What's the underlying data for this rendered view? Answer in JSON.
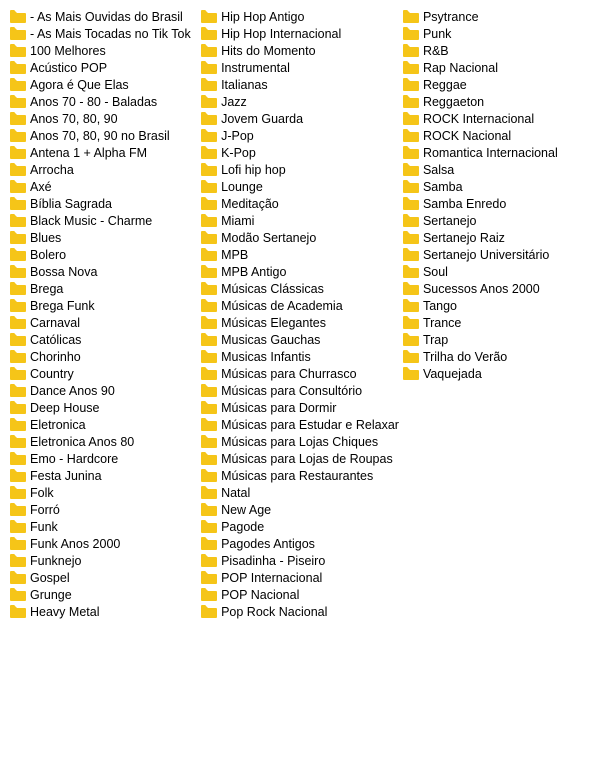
{
  "columns": [
    {
      "id": "col1",
      "items": [
        "- As Mais Ouvidas do Brasil",
        "- As Mais Tocadas no Tik Tok",
        "100 Melhores",
        "Acústico POP",
        "Agora é Que Elas",
        "Anos 70 - 80 - Baladas",
        "Anos 70, 80, 90",
        "Anos 70, 80, 90 no Brasil",
        "Antena 1 + Alpha FM",
        "Arrocha",
        "Axé",
        "Bíblia Sagrada",
        "Black Music - Charme",
        "Blues",
        "Bolero",
        "Bossa Nova",
        "Brega",
        "Brega Funk",
        "Carnaval",
        "Católicas",
        "Chorinho",
        "Country",
        "Dance Anos 90",
        "Deep House",
        "Eletronica",
        "Eletronica Anos 80",
        "Emo - Hardcore",
        "Festa Junina",
        "Folk",
        "Forró",
        "Funk",
        "Funk Anos 2000",
        "Funknejo",
        "Gospel",
        "Grunge",
        "Heavy Metal"
      ]
    },
    {
      "id": "col2",
      "items": [
        "Hip Hop Antigo",
        "Hip Hop Internacional",
        "Hits do Momento",
        "Instrumental",
        "Italianas",
        "Jazz",
        "Jovem Guarda",
        "J-Pop",
        "K-Pop",
        "Lofi hip hop",
        "Lounge",
        "Meditação",
        "Miami",
        "Modão Sertanejo",
        "MPB",
        "MPB Antigo",
        "Músicas Clássicas",
        "Músicas de Academia",
        "Músicas Elegantes",
        "Musicas Gauchas",
        "Musicas Infantis",
        "Músicas para Churrasco",
        "Músicas para Consultório",
        "Músicas para Dormir",
        "Músicas para Estudar e Relaxar",
        "Músicas para Lojas Chiques",
        "Músicas para Lojas de Roupas",
        "Músicas para Restaurantes",
        "Natal",
        "New Age",
        "Pagode",
        "Pagodes Antigos",
        "Pisadinha - Piseiro",
        "POP Internacional",
        "POP Nacional",
        "Pop Rock Nacional"
      ]
    },
    {
      "id": "col3",
      "items": [
        "Psytrance",
        "Punk",
        "R&B",
        "Rap Nacional",
        "Reggae",
        "Reggaeton",
        "ROCK Internacional",
        "ROCK Nacional",
        "Romantica Internacional",
        "Salsa",
        "Samba",
        "Samba Enredo",
        "Sertanejo",
        "Sertanejo Raiz",
        "Sertanejo Universitário",
        "Soul",
        "Sucessos Anos 2000",
        "Tango",
        "Trance",
        "Trap",
        "Trilha do Verão",
        "Vaquejada"
      ]
    }
  ],
  "folder_icon_color": "#F5C518"
}
